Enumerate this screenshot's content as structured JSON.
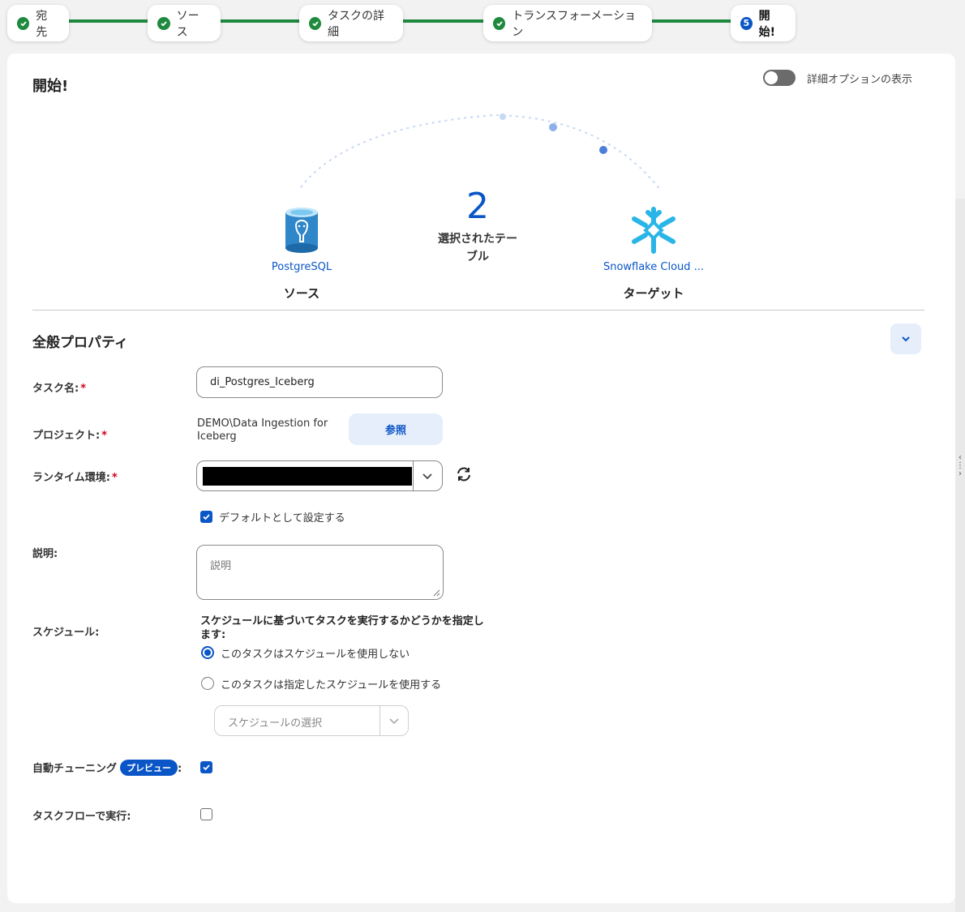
{
  "stepper": {
    "steps": [
      {
        "label": "宛先",
        "state": "done"
      },
      {
        "label": "ソース",
        "state": "done"
      },
      {
        "label": "タスクの詳細",
        "state": "done"
      },
      {
        "label": "トランスフォーメーション",
        "state": "done"
      },
      {
        "label": "開始!",
        "state": "active",
        "number": "5"
      }
    ]
  },
  "page": {
    "title": "開始!",
    "advanced_toggle_label": "詳細オプションの表示",
    "advanced_toggle_on": false
  },
  "flow": {
    "source": {
      "name": "PostgreSQL",
      "role": "ソース"
    },
    "tables": {
      "count": "2",
      "label_line1": "選択されたテー",
      "label_line2": "ブル"
    },
    "target": {
      "name": "Snowflake Cloud ...",
      "role": "ターゲット"
    }
  },
  "general": {
    "section_title": "全般プロパティ",
    "task_name_label": "タスク名:",
    "task_name_value": "di_Postgres_Iceberg",
    "project_label": "プロジェクト:",
    "project_value": "DEMO\\Data Ingestion for Iceberg",
    "browse_label": "参照",
    "runtime_label": "ランタイム環境:",
    "runtime_value_redacted": true,
    "default_checkbox_label": "デフォルトとして設定する",
    "default_checked": true,
    "description_label": "説明:",
    "description_placeholder": "説明",
    "schedule_label": "スケジュール:",
    "schedule_description": "スケジュールに基づいてタスクを実行するかどうかを指定します:",
    "schedule_option_none": "このタスクはスケジュールを使用しない",
    "schedule_option_use": "このタスクは指定したスケジュールを使用する",
    "schedule_selected": "none",
    "schedule_select_placeholder": "スケジュールの選択",
    "auto_tuning_label": "自動チューニング",
    "preview_badge": "プレビュー",
    "auto_tuning_suffix": ":",
    "auto_tuning_checked": true,
    "taskflow_label": "タスクフローで実行:",
    "taskflow_checked": false
  },
  "colors": {
    "accent": "#0b56c7",
    "success": "#1f8a3e",
    "required": "#d0021b"
  }
}
